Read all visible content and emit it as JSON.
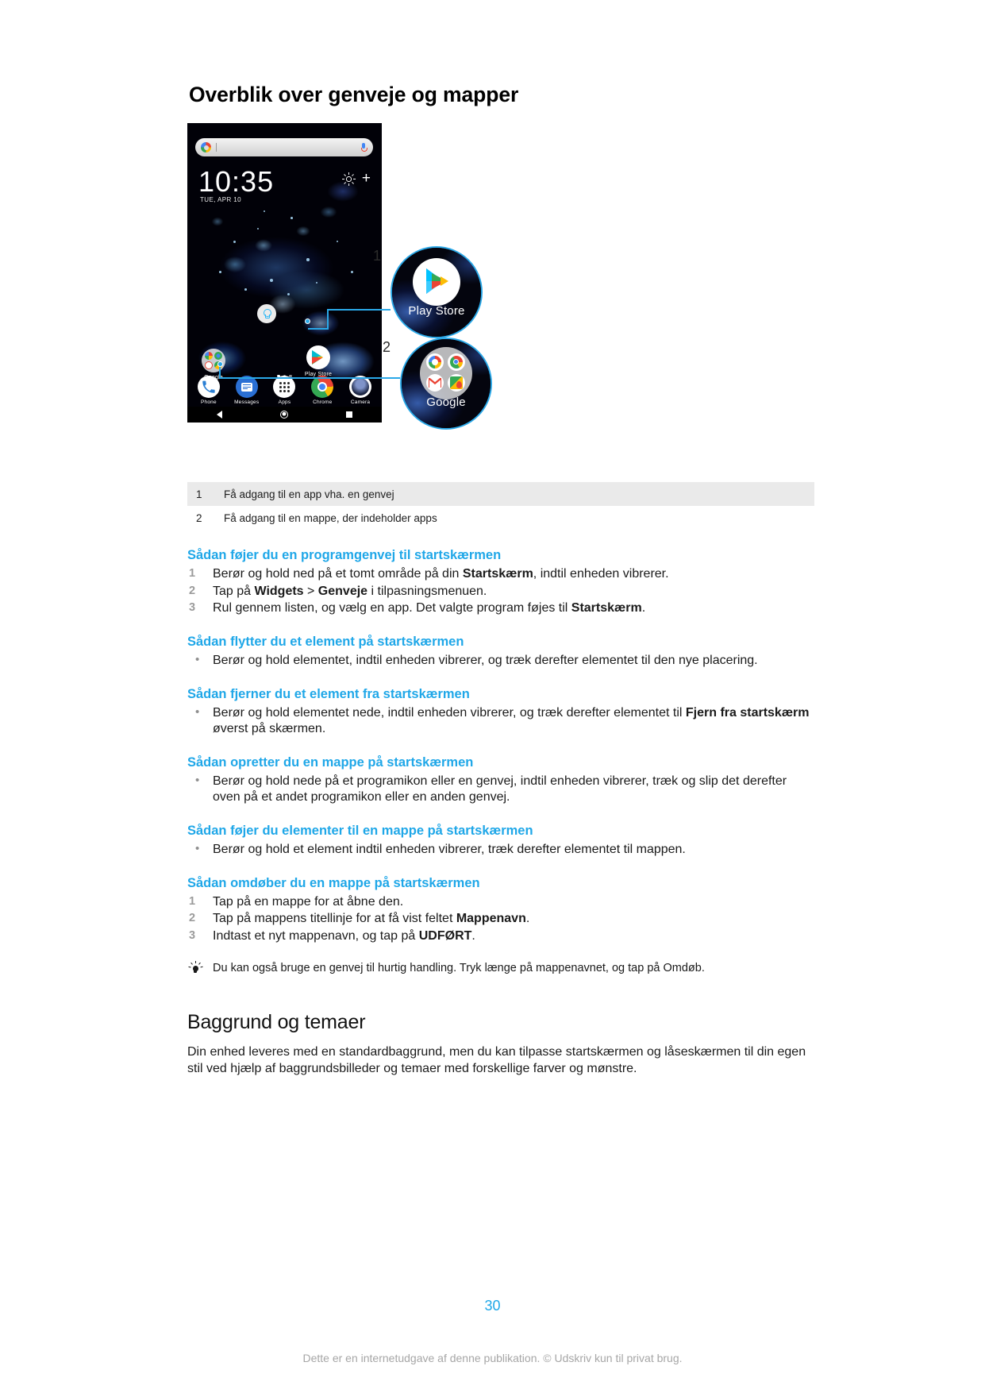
{
  "page": {
    "title": "Overblik over genveje og mapper",
    "page_number": "30",
    "footnote": "Dette er en internetudgave af denne publikation. © Udskriv kun til privat brug."
  },
  "illustration": {
    "phone_screen": {
      "search_placeholder": "",
      "search_logo": "google-g-icon",
      "mic_icon": "microphone-icon",
      "clock_time": "10:35",
      "clock_date": "TUE, APR 10",
      "weather_icon": "sun-icon",
      "add_icon": "+",
      "widget_icon": "lightbulb-icon",
      "home_icons": [
        {
          "label": "Google",
          "type": "folder"
        },
        {
          "label": "Play Store",
          "type": "app"
        }
      ],
      "dock": [
        {
          "label": "Phone",
          "icon": "phone-icon"
        },
        {
          "label": "Messages",
          "icon": "messages-icon"
        },
        {
          "label": "Apps",
          "icon": "app-drawer-icon"
        },
        {
          "label": "Chrome",
          "icon": "chrome-icon"
        },
        {
          "label": "Camera",
          "icon": "camera-icon"
        }
      ],
      "navbar": [
        "back-icon",
        "home-icon",
        "recents-icon"
      ]
    },
    "callouts": [
      {
        "number": "1",
        "label": "Play Store",
        "icon": "play-store-icon"
      },
      {
        "number": "2",
        "label": "Google",
        "icon": "google-folder-icon"
      }
    ]
  },
  "caption_table": {
    "rows": [
      {
        "num": "1",
        "text": "Få adgang til en app vha. en genvej"
      },
      {
        "num": "2",
        "text": "Få adgang til en mappe, der indeholder apps"
      }
    ]
  },
  "sections": [
    {
      "heading": "Sådan føjer du en programgenvej til startskærmen",
      "type": "ordered",
      "items": [
        "Berør og hold ned på et tomt område på din <b>Startskærm</b>, indtil enheden vibrerer.",
        "Tap på <b>Widgets</b> > <b>Genveje</b> i tilpasningsmenuen.",
        "Rul gennem listen, og vælg en app. Det valgte program føjes til <b>Startskærm</b>."
      ]
    },
    {
      "heading": "Sådan flytter du et element på startskærmen",
      "type": "bullet",
      "items": [
        "Berør og hold elementet, indtil enheden vibrerer, og træk derefter elementet til den nye placering."
      ]
    },
    {
      "heading": "Sådan fjerner du et element fra startskærmen",
      "type": "bullet",
      "items": [
        "Berør og hold elementet nede, indtil enheden vibrerer, og træk derefter elementet til <b>Fjern fra startskærm</b> øverst på skærmen."
      ]
    },
    {
      "heading": "Sådan opretter du en mappe på startskærmen",
      "type": "bullet",
      "items": [
        "Berør og hold nede på et programikon eller en genvej, indtil enheden vibrerer, træk og slip det derefter oven på et andet programikon eller en anden genvej."
      ]
    },
    {
      "heading": "Sådan føjer du elementer til en mappe på startskærmen",
      "type": "bullet",
      "items": [
        "Berør og hold et element indtil enheden vibrerer, træk derefter elementet til mappen."
      ]
    },
    {
      "heading": "Sådan omdøber du en mappe på startskærmen",
      "type": "ordered",
      "items": [
        "Tap på en mappe for at åbne den.",
        "Tap på mappens titellinje for at få vist feltet <b>Mappenavn</b>.",
        "Indtast et nyt mappenavn, og tap på <b>UDFØRT</b>."
      ]
    }
  ],
  "tip": {
    "icon": "lightbulb-icon",
    "text": "Du kan også bruge en genvej til hurtig handling. Tryk længe på mappenavnet, og tap på Omdøb."
  },
  "next_section": {
    "heading": "Baggrund og temaer",
    "paragraph": "Din enhed leveres med en standardbaggrund, men du kan tilpasse startskærmen og låseskærmen til din egen stil ved hjælp af baggrundsbilleder og temaer med forskellige farver og mønstre."
  },
  "colors": {
    "accent_blue": "#1fa7e8",
    "callout_blue": "#2aa8e8",
    "table_alt_row": "#eaeaea",
    "step_number": "#9b9b9b",
    "footnote_gray": "#a6a6a6"
  }
}
